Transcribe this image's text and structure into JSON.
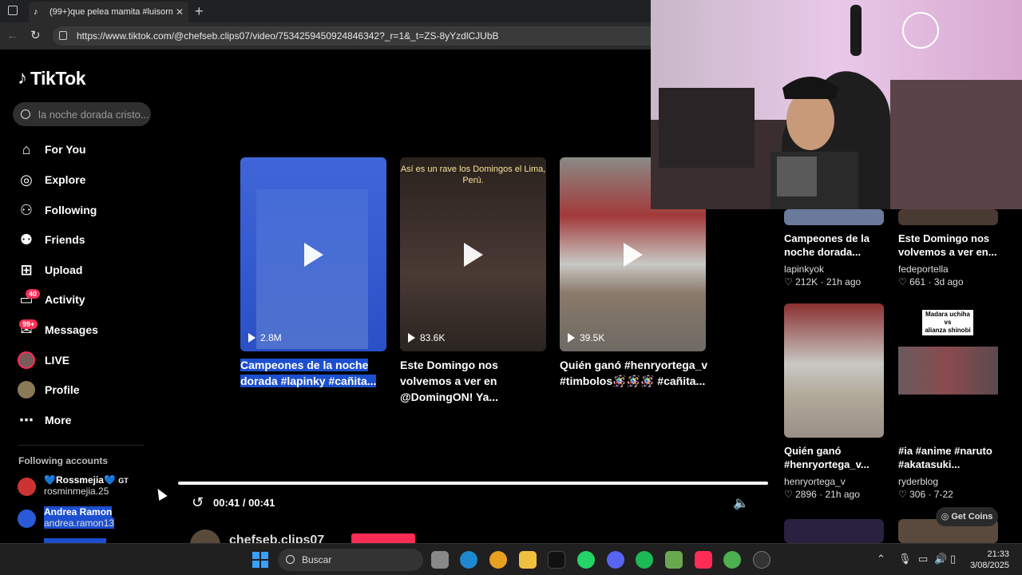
{
  "browser": {
    "tab_title": "(99+)que pelea mamita #luisorm",
    "url": "https://www.tiktok.com/@chefseb.clips07/video/7534259450924846342?_r=1&_t=ZS-8yYzdlCJUbB"
  },
  "sidebar": {
    "logo": "TikTok",
    "search_placeholder": "la noche dorada cristo...",
    "nav": [
      {
        "label": "For You",
        "icon": "home-icon"
      },
      {
        "label": "Explore",
        "icon": "compass-icon"
      },
      {
        "label": "Following",
        "icon": "following-icon"
      },
      {
        "label": "Friends",
        "icon": "friends-icon"
      },
      {
        "label": "Upload",
        "icon": "upload-icon"
      },
      {
        "label": "Activity",
        "icon": "activity-icon",
        "badge": "40"
      },
      {
        "label": "Messages",
        "icon": "messages-icon",
        "badge": "99+"
      },
      {
        "label": "LIVE",
        "icon": "live-icon"
      },
      {
        "label": "Profile",
        "icon": "profile-icon"
      },
      {
        "label": "More",
        "icon": "more-icon"
      }
    ],
    "following_header": "Following accounts",
    "accounts": [
      {
        "name": "💙Rossmejia💙",
        "tag": "GT",
        "handle": "rosminmejia.25"
      },
      {
        "name": "Andrea Ramon",
        "handle": "andrea.ramon13"
      }
    ]
  },
  "videos": [
    {
      "views": "2.8M",
      "caption": "Campeones de la noche dorada #lapinky #cañita...",
      "overlay": ""
    },
    {
      "views": "83.6K",
      "caption": "Este Domingo nos volvemos a ver en @DomingON! Ya...",
      "overlay": "Así es un rave los Domingos el Lima, Perú."
    },
    {
      "views": "39.5K",
      "caption": "Quién ganó #henryortega_v #timbolos🪅🪅🪅 #cañita...",
      "overlay": ""
    }
  ],
  "player": {
    "time": "00:41 / 00:41",
    "author": "chefseb.clips07"
  },
  "recommendations": [
    {
      "title": "Campeones de la noche dorada...",
      "author": "lapinkyok",
      "likes": "212K",
      "age": "21h ago"
    },
    {
      "title": "Este Domingo nos volvemos a ver en...",
      "author": "fedeportella",
      "likes": "661",
      "age": "3d ago"
    },
    {
      "title": "Quién ganó #henryortega_v...",
      "author": "henryortega_v",
      "likes": "2896",
      "age": "21h ago"
    },
    {
      "title": "#ia #anime #naruto #akatasuki...",
      "author": "ryderblog",
      "likes": "306",
      "age": "7-22",
      "thumb_text": [
        "Madara uchiha",
        "vs",
        "alianza shinobi"
      ]
    }
  ],
  "get_coins": "Get Coins",
  "taskbar": {
    "search_placeholder": "Buscar",
    "time": "21:33",
    "date": "3/08/2025"
  }
}
